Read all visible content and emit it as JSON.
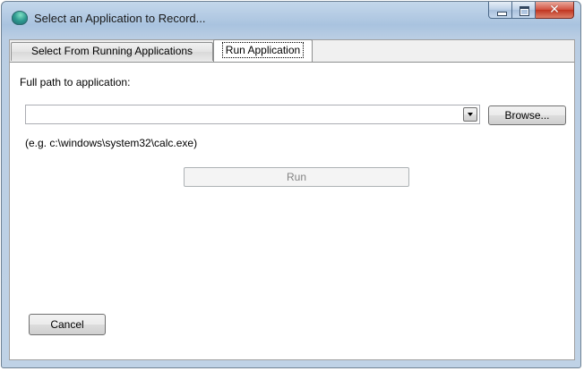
{
  "window": {
    "title": "Select an Application to Record...",
    "close_glyph": "✕"
  },
  "tabs": [
    {
      "label": "Select From Running Applications",
      "selected": false
    },
    {
      "label": "Run Application",
      "selected": true
    }
  ],
  "run_panel": {
    "path_label": "Full path to application:",
    "path_value": "",
    "browse_label": "Browse...",
    "example_text": "(e.g. c:\\windows\\system32\\calc.exe)",
    "run_label": "Run",
    "run_enabled": false
  },
  "cancel_label": "Cancel",
  "icons": {
    "app": "app-globe-icon",
    "minimize": "minimize-icon",
    "maximize": "maximize-icon",
    "close": "close-icon",
    "dropdown": "chevron-down-icon"
  },
  "colors": {
    "title_bar": "#a9c3df",
    "close_button": "#c03520",
    "panel_background": "#ffffff",
    "disabled_text": "#838383"
  }
}
